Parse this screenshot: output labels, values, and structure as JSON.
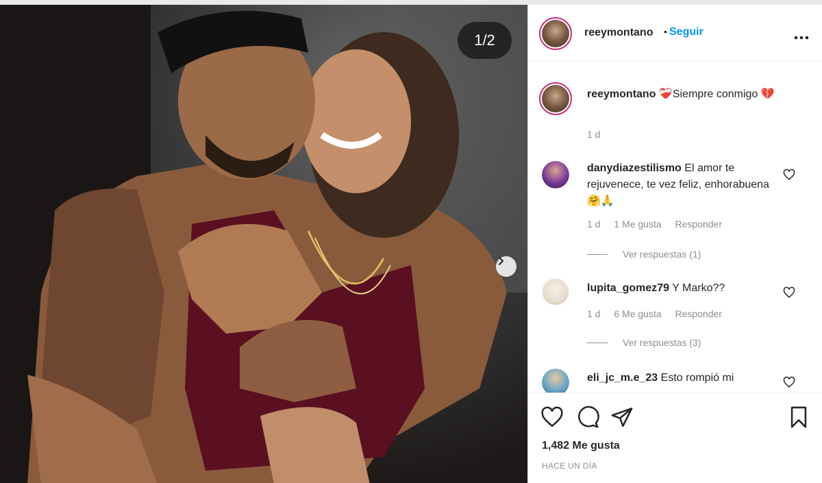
{
  "post": {
    "counter": "1/2",
    "author": "reeymontano",
    "follow_label": "Seguir",
    "more_label": "•••"
  },
  "caption": {
    "username": "reeymontano",
    "text": "❤️‍🩹Siempre conmigo 💔",
    "age": "1 d"
  },
  "comments": [
    {
      "username": "danydiazestilismo",
      "text": "El amor te rejuvenece, te vez feliz, enhorabuena🤗🙏",
      "age": "1 d",
      "likes": "1 Me gusta",
      "reply_label": "Responder",
      "view_replies": "Ver respuestas (1)"
    },
    {
      "username": "lupita_gomez79",
      "text": "Y Marko??",
      "age": "1 d",
      "likes": "6 Me gusta",
      "reply_label": "Responder",
      "view_replies": "Ver respuestas (3)"
    },
    {
      "username": "eli_jc_m.e_23",
      "text": "Esto rompió mi"
    }
  ],
  "footer": {
    "likes": "1,482 Me gusta",
    "time_ago": "HACE UN DÍA"
  },
  "colors": {
    "link": "#0095f6",
    "muted": "#8e8e8e",
    "story_ring": "#c7317c"
  }
}
